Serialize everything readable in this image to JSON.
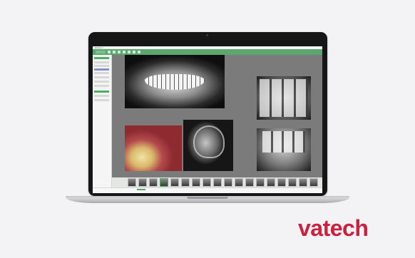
{
  "app": {
    "titlebar_text": "EzDent-i",
    "accent_color": "#5aa86f",
    "sidebar_accent_color": "#4caf62"
  },
  "viewer": {
    "panels": [
      {
        "name": "panoramic-xray",
        "label": ""
      },
      {
        "name": "bitewing-xray-upper",
        "label": ""
      },
      {
        "name": "bitewing-xray-lower",
        "label": ""
      },
      {
        "name": "intraoral-photo",
        "label": ""
      },
      {
        "name": "cephalometric-xray",
        "label": ""
      }
    ]
  },
  "filmstrip": {
    "thumbnail_count": 18
  },
  "brand": {
    "logo_text": "vatech",
    "logo_color": "#c9213f"
  }
}
